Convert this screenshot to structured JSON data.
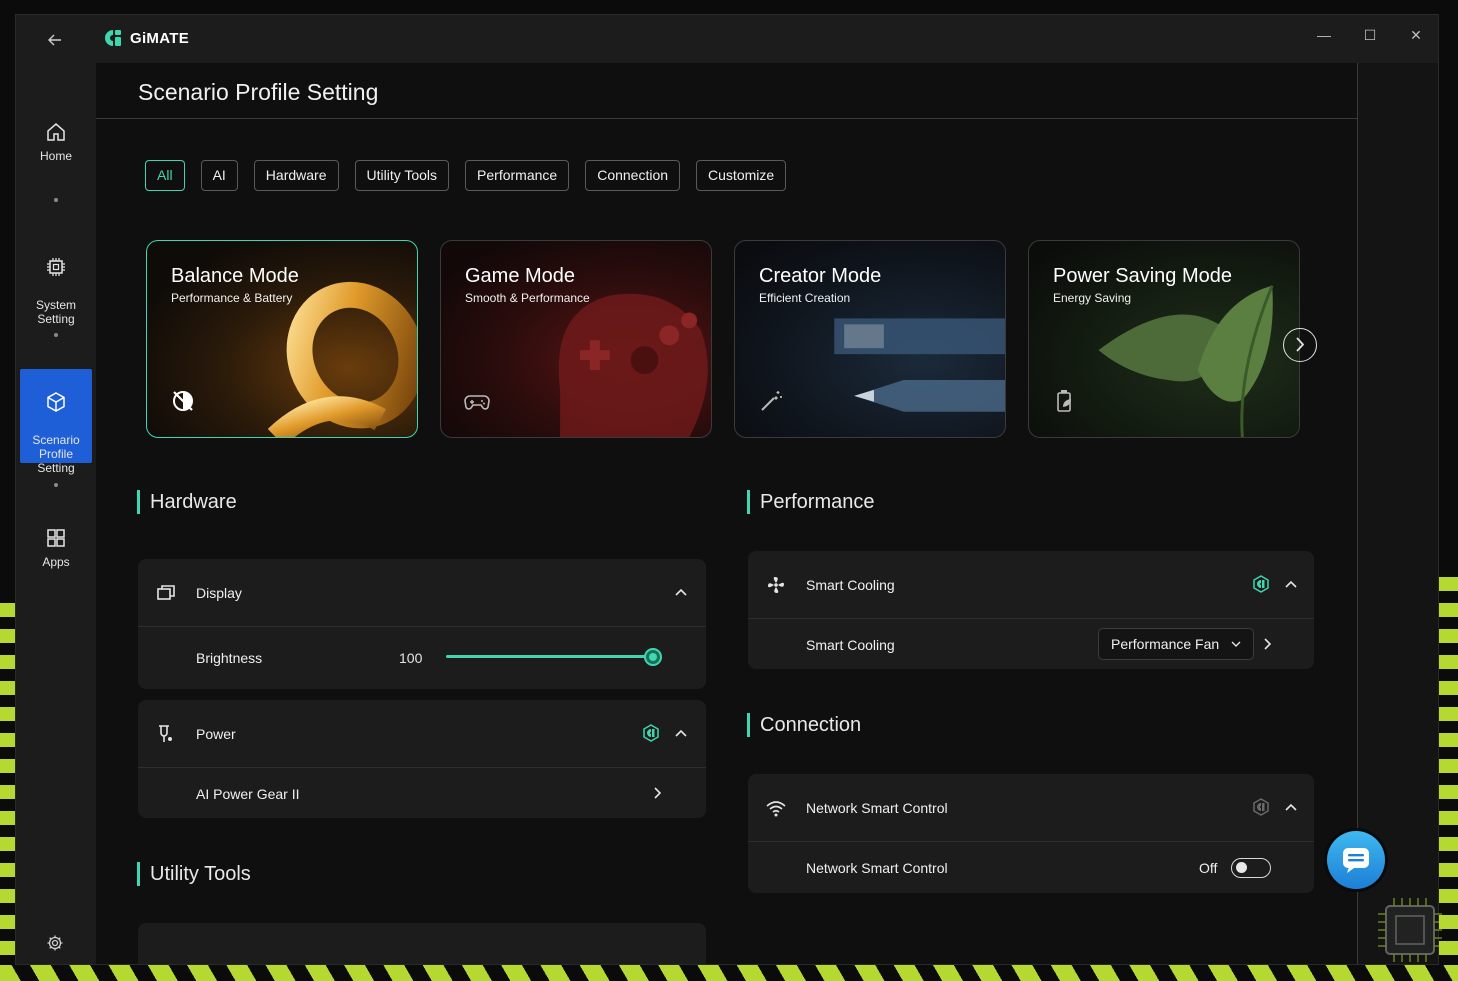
{
  "app": {
    "name": "GiMATE"
  },
  "window_controls": {
    "minimize": "—",
    "maximize": "☐",
    "close": "✕"
  },
  "sidebar": {
    "items": [
      {
        "label": "Home",
        "icon": "home-icon"
      },
      {
        "label": "System\nSetting",
        "icon": "chip-icon"
      },
      {
        "label": "Scenario\nProfile\nSetting",
        "icon": "cube-icon",
        "active": true
      },
      {
        "label": "Apps",
        "icon": "apps-grid-icon"
      }
    ]
  },
  "page": {
    "title": "Scenario Profile Setting"
  },
  "filters": [
    "All",
    "AI",
    "Hardware",
    "Utility Tools",
    "Performance",
    "Connection",
    "Customize"
  ],
  "active_filter": "All",
  "cards": [
    {
      "title": "Balance Mode",
      "subtitle": "Performance & Battery",
      "icon": "balance-icon",
      "active": true
    },
    {
      "title": "Game Mode",
      "subtitle": "Smooth & Performance",
      "icon": "gamepad-icon"
    },
    {
      "title": "Creator Mode",
      "subtitle": "Efficient Creation",
      "icon": "magic-wand-icon"
    },
    {
      "title": "Power Saving Mode",
      "subtitle": "Energy Saving",
      "icon": "battery-leaf-icon"
    }
  ],
  "hardware": {
    "section_title": "Hardware",
    "display": {
      "label": "Display",
      "brightness_label": "Brightness",
      "brightness_value": "100"
    },
    "power": {
      "label": "Power",
      "row_label": "AI Power Gear II"
    }
  },
  "utility": {
    "section_title": "Utility Tools"
  },
  "performance": {
    "section_title": "Performance",
    "smart_cooling": {
      "label": "Smart Cooling",
      "row_label": "Smart Cooling",
      "dropdown_value": "Performance Fan"
    }
  },
  "connection": {
    "section_title": "Connection",
    "network": {
      "label": "Network Smart Control",
      "row_label": "Network Smart Control",
      "state": "Off"
    }
  },
  "colors": {
    "accent": "#3fd6b0",
    "nav_active": "#1e5fd8",
    "fab": "#2a97e4"
  }
}
